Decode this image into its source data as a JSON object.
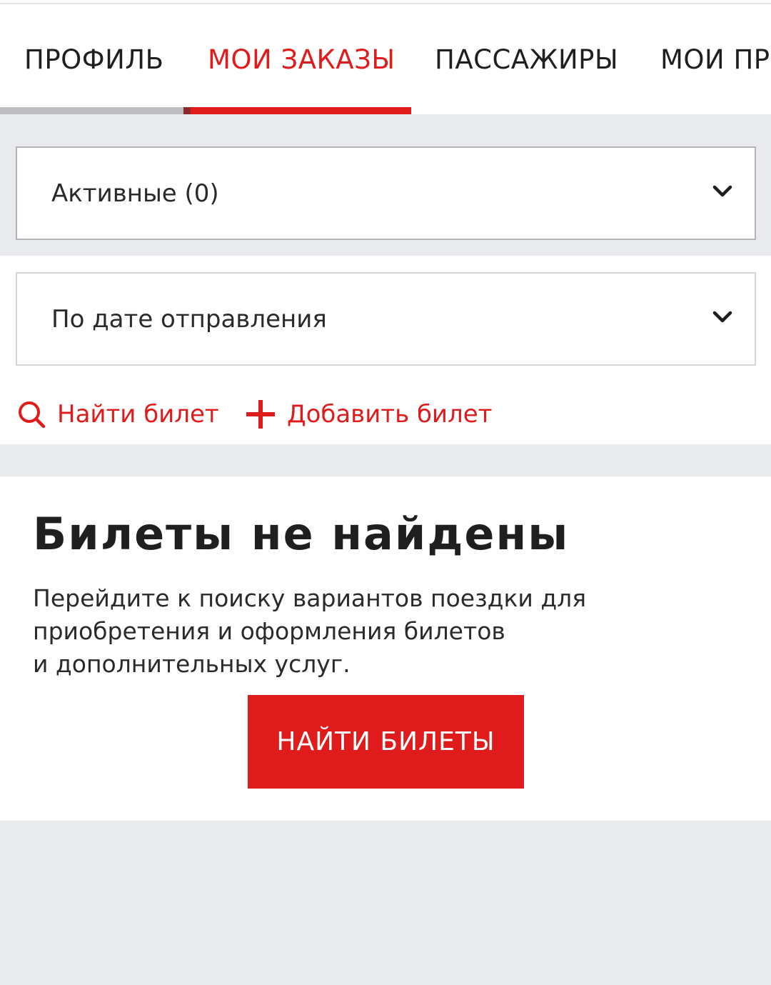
{
  "tabs": [
    {
      "label": "ПРОФИЛЬ",
      "active": false
    },
    {
      "label": "МОИ ЗАКАЗЫ",
      "active": true
    },
    {
      "label": "ПАССАЖИРЫ",
      "active": false
    },
    {
      "label": "МОИ ПРЕ",
      "active": false
    }
  ],
  "filters": {
    "status_select": {
      "value": "Активные (0)",
      "icon": "chevron-down-icon"
    },
    "sort_select": {
      "value": "По дате отправления",
      "icon": "chevron-down-icon"
    }
  },
  "actions": {
    "find_ticket": {
      "label": "Найти билет",
      "icon": "search-icon"
    },
    "add_ticket": {
      "label": "Добавить билет",
      "icon": "plus-icon"
    }
  },
  "empty_state": {
    "title": "Билеты не найдены",
    "text_lines": [
      "Перейдите к поиску вариантов поездки для",
      "приобретения и оформления билетов",
      "и дополнительных услуг."
    ],
    "button_label": "НАЙТИ БИЛЕТЫ"
  },
  "colors": {
    "accent": "#e01b1b",
    "background": "#e9eaee",
    "text": "#1f1f1f"
  }
}
